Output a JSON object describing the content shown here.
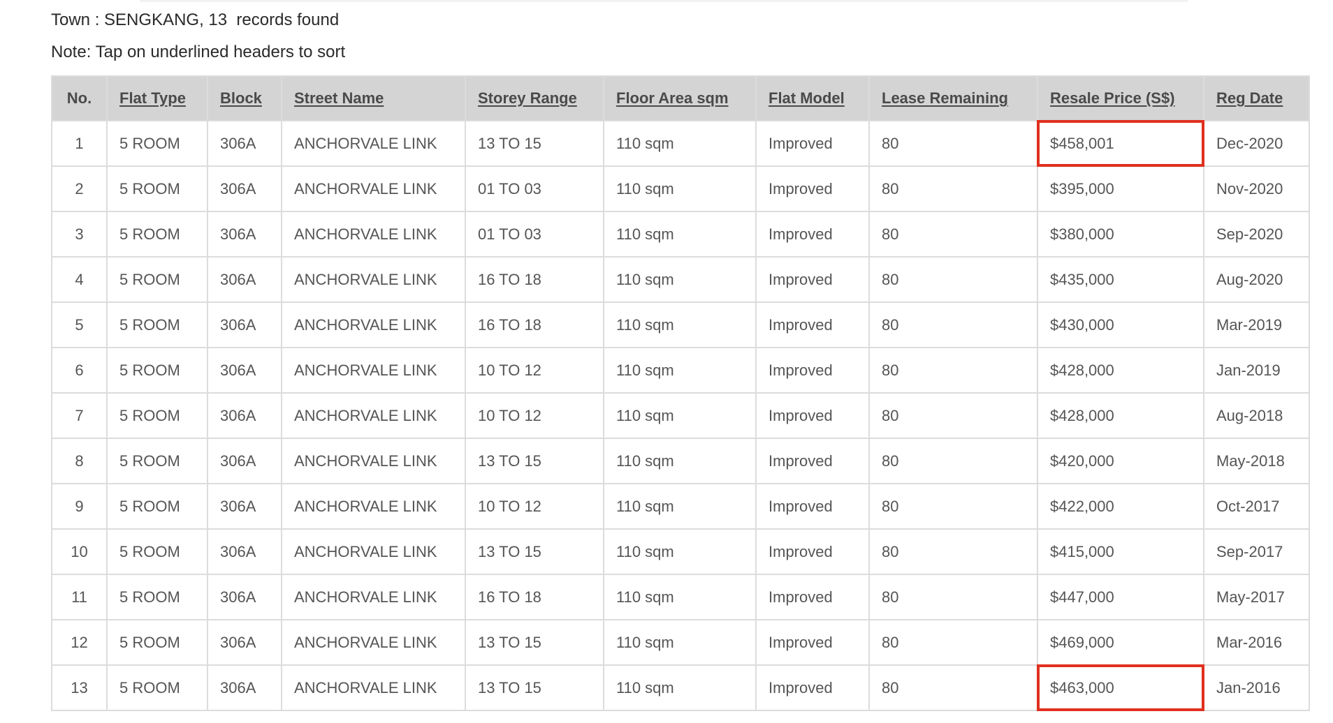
{
  "summary": {
    "town_line": "Town : SENGKANG, 13  records found",
    "note_line": "Note: Tap on underlined headers to sort"
  },
  "accent_color": "#e0301e",
  "table": {
    "columns": [
      {
        "key": "no",
        "label": "No.",
        "sortable": false
      },
      {
        "key": "flat_type",
        "label": "Flat Type",
        "sortable": true
      },
      {
        "key": "block",
        "label": "Block",
        "sortable": true
      },
      {
        "key": "street_name",
        "label": "Street Name",
        "sortable": true
      },
      {
        "key": "storey_range",
        "label": "Storey Range",
        "sortable": true
      },
      {
        "key": "floor_area",
        "label": "Floor Area sqm",
        "sortable": true
      },
      {
        "key": "flat_model",
        "label": "Flat Model",
        "sortable": true
      },
      {
        "key": "lease_remaining",
        "label": "Lease Remaining",
        "sortable": true
      },
      {
        "key": "resale_price",
        "label": "Resale Price (S$)",
        "sortable": true
      },
      {
        "key": "reg_date",
        "label": "Reg Date",
        "sortable": true
      }
    ],
    "rows": [
      {
        "no": "1",
        "flat_type": "5 ROOM",
        "block": "306A",
        "street_name": "ANCHORVALE LINK",
        "storey_range": "13 TO 15",
        "floor_area": "110 sqm",
        "flat_model": "Improved",
        "lease_remaining": "80",
        "resale_price": "$458,001",
        "reg_date": "Dec-2020",
        "price_highlighted": true
      },
      {
        "no": "2",
        "flat_type": "5 ROOM",
        "block": "306A",
        "street_name": "ANCHORVALE LINK",
        "storey_range": "01 TO 03",
        "floor_area": "110 sqm",
        "flat_model": "Improved",
        "lease_remaining": "80",
        "resale_price": "$395,000",
        "reg_date": "Nov-2020",
        "price_highlighted": false
      },
      {
        "no": "3",
        "flat_type": "5 ROOM",
        "block": "306A",
        "street_name": "ANCHORVALE LINK",
        "storey_range": "01 TO 03",
        "floor_area": "110 sqm",
        "flat_model": "Improved",
        "lease_remaining": "80",
        "resale_price": "$380,000",
        "reg_date": "Sep-2020",
        "price_highlighted": false
      },
      {
        "no": "4",
        "flat_type": "5 ROOM",
        "block": "306A",
        "street_name": "ANCHORVALE LINK",
        "storey_range": "16 TO 18",
        "floor_area": "110 sqm",
        "flat_model": "Improved",
        "lease_remaining": "80",
        "resale_price": "$435,000",
        "reg_date": "Aug-2020",
        "price_highlighted": false
      },
      {
        "no": "5",
        "flat_type": "5 ROOM",
        "block": "306A",
        "street_name": "ANCHORVALE LINK",
        "storey_range": "16 TO 18",
        "floor_area": "110 sqm",
        "flat_model": "Improved",
        "lease_remaining": "80",
        "resale_price": "$430,000",
        "reg_date": "Mar-2019",
        "price_highlighted": false
      },
      {
        "no": "6",
        "flat_type": "5 ROOM",
        "block": "306A",
        "street_name": "ANCHORVALE LINK",
        "storey_range": "10 TO 12",
        "floor_area": "110 sqm",
        "flat_model": "Improved",
        "lease_remaining": "80",
        "resale_price": "$428,000",
        "reg_date": "Jan-2019",
        "price_highlighted": false
      },
      {
        "no": "7",
        "flat_type": "5 ROOM",
        "block": "306A",
        "street_name": "ANCHORVALE LINK",
        "storey_range": "10 TO 12",
        "floor_area": "110 sqm",
        "flat_model": "Improved",
        "lease_remaining": "80",
        "resale_price": "$428,000",
        "reg_date": "Aug-2018",
        "price_highlighted": false
      },
      {
        "no": "8",
        "flat_type": "5 ROOM",
        "block": "306A",
        "street_name": "ANCHORVALE LINK",
        "storey_range": "13 TO 15",
        "floor_area": "110 sqm",
        "flat_model": "Improved",
        "lease_remaining": "80",
        "resale_price": "$420,000",
        "reg_date": "May-2018",
        "price_highlighted": false
      },
      {
        "no": "9",
        "flat_type": "5 ROOM",
        "block": "306A",
        "street_name": "ANCHORVALE LINK",
        "storey_range": "10 TO 12",
        "floor_area": "110 sqm",
        "flat_model": "Improved",
        "lease_remaining": "80",
        "resale_price": "$422,000",
        "reg_date": "Oct-2017",
        "price_highlighted": false
      },
      {
        "no": "10",
        "flat_type": "5 ROOM",
        "block": "306A",
        "street_name": "ANCHORVALE LINK",
        "storey_range": "13 TO 15",
        "floor_area": "110 sqm",
        "flat_model": "Improved",
        "lease_remaining": "80",
        "resale_price": "$415,000",
        "reg_date": "Sep-2017",
        "price_highlighted": false
      },
      {
        "no": "11",
        "flat_type": "5 ROOM",
        "block": "306A",
        "street_name": "ANCHORVALE LINK",
        "storey_range": "16 TO 18",
        "floor_area": "110 sqm",
        "flat_model": "Improved",
        "lease_remaining": "80",
        "resale_price": "$447,000",
        "reg_date": "May-2017",
        "price_highlighted": false
      },
      {
        "no": "12",
        "flat_type": "5 ROOM",
        "block": "306A",
        "street_name": "ANCHORVALE LINK",
        "storey_range": "13 TO 15",
        "floor_area": "110 sqm",
        "flat_model": "Improved",
        "lease_remaining": "80",
        "resale_price": "$469,000",
        "reg_date": "Mar-2016",
        "price_highlighted": false
      },
      {
        "no": "13",
        "flat_type": "5 ROOM",
        "block": "306A",
        "street_name": "ANCHORVALE LINK",
        "storey_range": "13 TO 15",
        "floor_area": "110 sqm",
        "flat_model": "Improved",
        "lease_remaining": "80",
        "resale_price": "$463,000",
        "reg_date": "Jan-2016",
        "price_highlighted": true
      }
    ]
  }
}
